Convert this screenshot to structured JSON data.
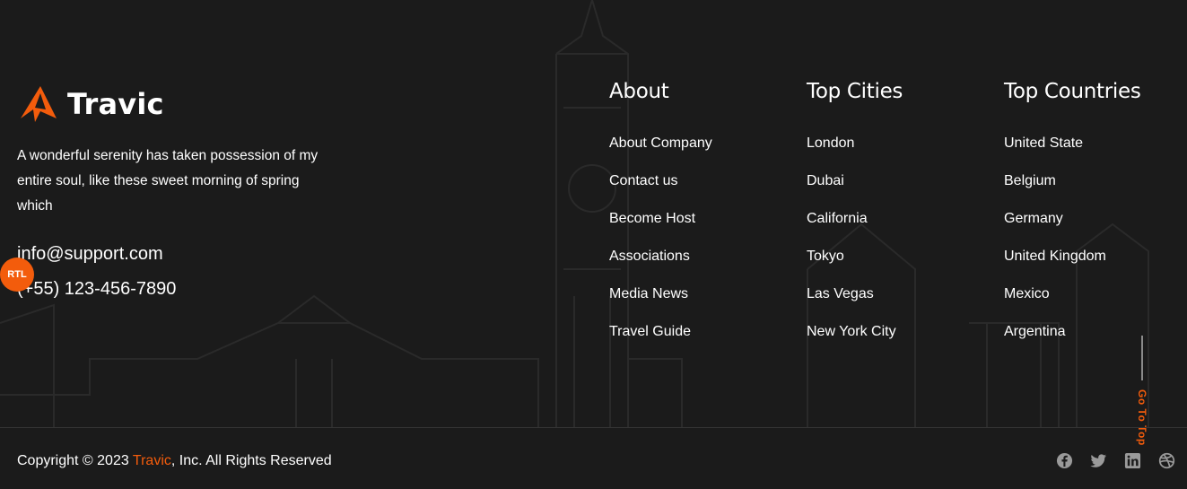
{
  "brand": {
    "name": "Travic",
    "accent_color": "#f35c0c",
    "logo_icon": "paper-plane-logo-icon"
  },
  "about_text": "A wonderful serenity has taken possession of my entire soul, like these sweet morning of spring which",
  "contact": {
    "email": "info@support.com",
    "phone": "(+55) 123-456-7890"
  },
  "rtl_badge": "RTL",
  "columns": [
    {
      "title": "About",
      "links": [
        "About Company",
        "Contact us",
        "Become Host",
        "Associations",
        "Media News",
        "Travel Guide"
      ]
    },
    {
      "title": "Top Cities",
      "links": [
        "London",
        "Dubai",
        "California",
        "Tokyo",
        "Las Vegas",
        "New York City"
      ]
    },
    {
      "title": "Top Countries",
      "links": [
        "United State",
        "Belgium",
        "Germany",
        "United Kingdom",
        "Mexico",
        "Argentina"
      ]
    }
  ],
  "copyright": {
    "prefix": "Copyright © 2023 ",
    "brand": "Travic",
    "suffix": ", Inc. All Rights Reserved"
  },
  "go_to_top": "Go To Top",
  "social_icons": [
    "facebook-icon",
    "twitter-icon",
    "linkedin-icon",
    "dribbble-icon"
  ],
  "colors": {
    "background": "#1b1b1b",
    "text": "#ffffff",
    "accent": "#f35c0c",
    "icon": "#9a9a9a"
  }
}
